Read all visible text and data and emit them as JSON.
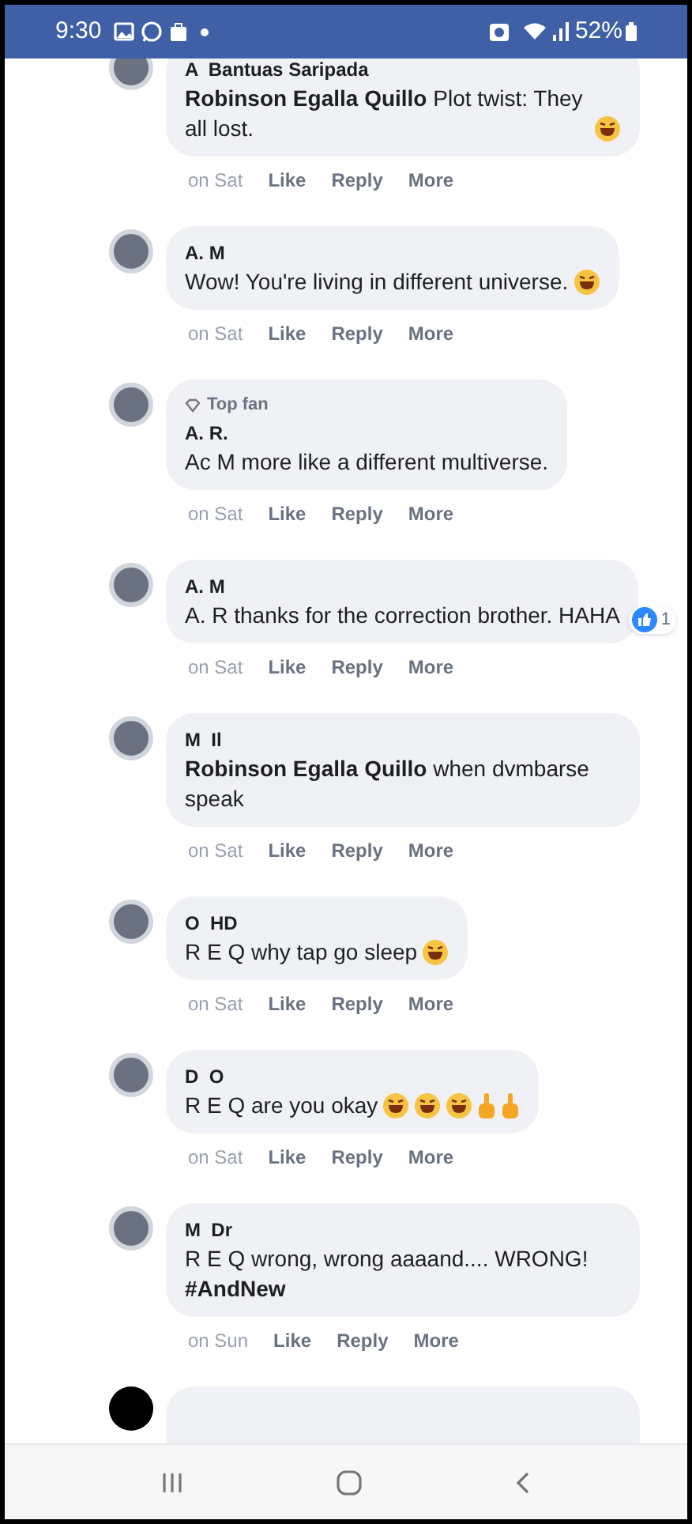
{
  "status_bar": {
    "time": "9:30",
    "battery": "52%"
  },
  "comments": [
    {
      "author": "A  Bantuas Saripada",
      "text": "**Robinson Egalla Quillo** Plot twist: They all lost.",
      "emojis": [
        {
          "kind": "laugh"
        }
      ],
      "time": "on Sat",
      "actions": [
        "Like",
        "Reply",
        "More"
      ]
    },
    {
      "author": "A. M",
      "text": "Wow! You're living in different universe.",
      "emojis": [
        {
          "kind": "laugh"
        }
      ],
      "time": "on Sat",
      "actions": [
        "Like",
        "Reply",
        "More"
      ]
    },
    {
      "badge": "Top fan",
      "author": "A. R.",
      "text": "Ac  M  more like a different multiverse.",
      "time": "on Sat",
      "actions": [
        "Like",
        "Reply",
        "More"
      ]
    },
    {
      "author": "A. M",
      "text": "A. R thanks for the correction brother. HAHA",
      "reaction_count": "1",
      "time": "on Sat",
      "actions": [
        "Like",
        "Reply",
        "More"
      ]
    },
    {
      "author": "M  Il",
      "text": "**Robinson Egalla Quillo** when dvmbarse speak",
      "time": "on Sat",
      "actions": [
        "Like",
        "Reply",
        "More"
      ]
    },
    {
      "author": "O  HD",
      "text": "R  E  Q  why tap go sleep",
      "emojis": [
        {
          "kind": "laugh"
        }
      ],
      "time": "on Sat",
      "actions": [
        "Like",
        "Reply",
        "More"
      ]
    },
    {
      "author": "D  O",
      "text": "R  E  Q  are you okay",
      "emojis": [
        {
          "kind": "laugh"
        },
        {
          "kind": "laugh"
        },
        {
          "kind": "laugh"
        },
        {
          "kind": "hand"
        },
        {
          "kind": "hand"
        }
      ],
      "time": "on Sat",
      "actions": [
        "Like",
        "Reply",
        "More"
      ]
    },
    {
      "author": "M  Dr",
      "text": "R  E  Q  wrong, wrong aaaand.... WRONG! **#AndNew**",
      "time": "on Sun",
      "actions": [
        "Like",
        "Reply",
        "More"
      ]
    }
  ]
}
